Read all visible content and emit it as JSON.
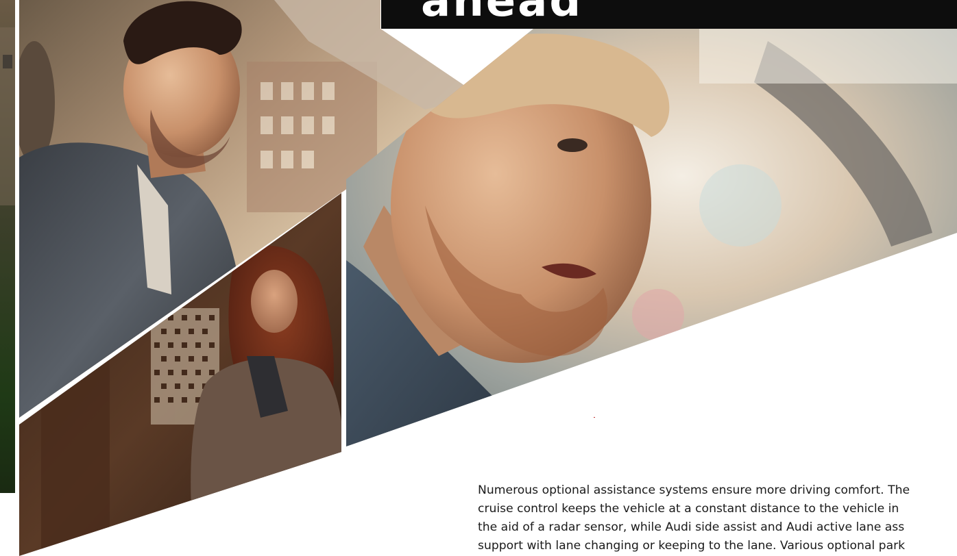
{
  "header": {
    "title": "ahead"
  },
  "body": {
    "lines": [
      "Numerous optional assistance systems ensure more driving comfort. The",
      "cruise control keeps the vehicle at a constant distance to the vehicle in",
      "the aid of a radar sensor, while Audi side assist and Audi active lane ass",
      "support with lane changing or keeping to the lane. Various optional park"
    ]
  },
  "colors": {
    "title_bar": "#0d0d0d",
    "title_text": "#ffffff",
    "body_text": "#1a1a1a",
    "page_background": "#ffffff"
  },
  "photos": [
    {
      "name": "left-edge-photo",
      "subject": "car interior edge, dark green"
    },
    {
      "name": "driver-profile-photo",
      "subject": "man in tweed jacket driving, looking right"
    },
    {
      "name": "woman-street-photo",
      "subject": "woman with red hair in brown leather jacket"
    },
    {
      "name": "driver-closeup-photo",
      "subject": "close-up of bearded blond driver"
    }
  ]
}
